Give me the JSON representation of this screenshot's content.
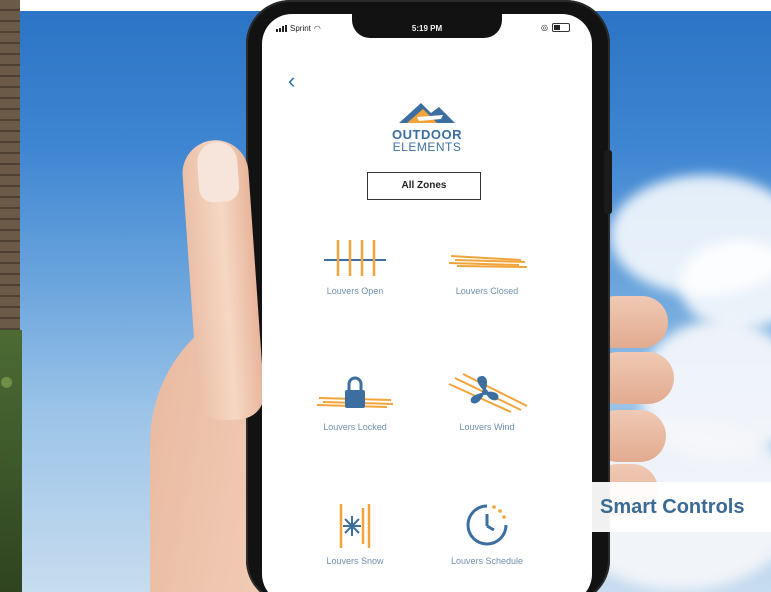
{
  "status_bar": {
    "carrier": "Sprint",
    "time": "5:19 PM"
  },
  "app": {
    "back_icon": "chevron-left-icon",
    "logo_line1": "OUTDOOR",
    "logo_line2": "ELEMENTS",
    "zone_selector": "All Zones",
    "accent_color": "#f2a43a",
    "brand_color": "#3c6fa0"
  },
  "tiles": [
    {
      "label": "Louvers Open",
      "icon": "louvers-open-icon"
    },
    {
      "label": "Louvers Closed",
      "icon": "louvers-closed-icon"
    },
    {
      "label": "Louvers Locked",
      "icon": "louvers-locked-icon"
    },
    {
      "label": "Louvers Wind",
      "icon": "louvers-wind-icon"
    },
    {
      "label": "Louvers Snow",
      "icon": "louvers-snow-icon"
    },
    {
      "label": "Louvers Schedule",
      "icon": "louvers-schedule-icon"
    }
  ],
  "overlay": {
    "caption": "Smart Controls"
  }
}
